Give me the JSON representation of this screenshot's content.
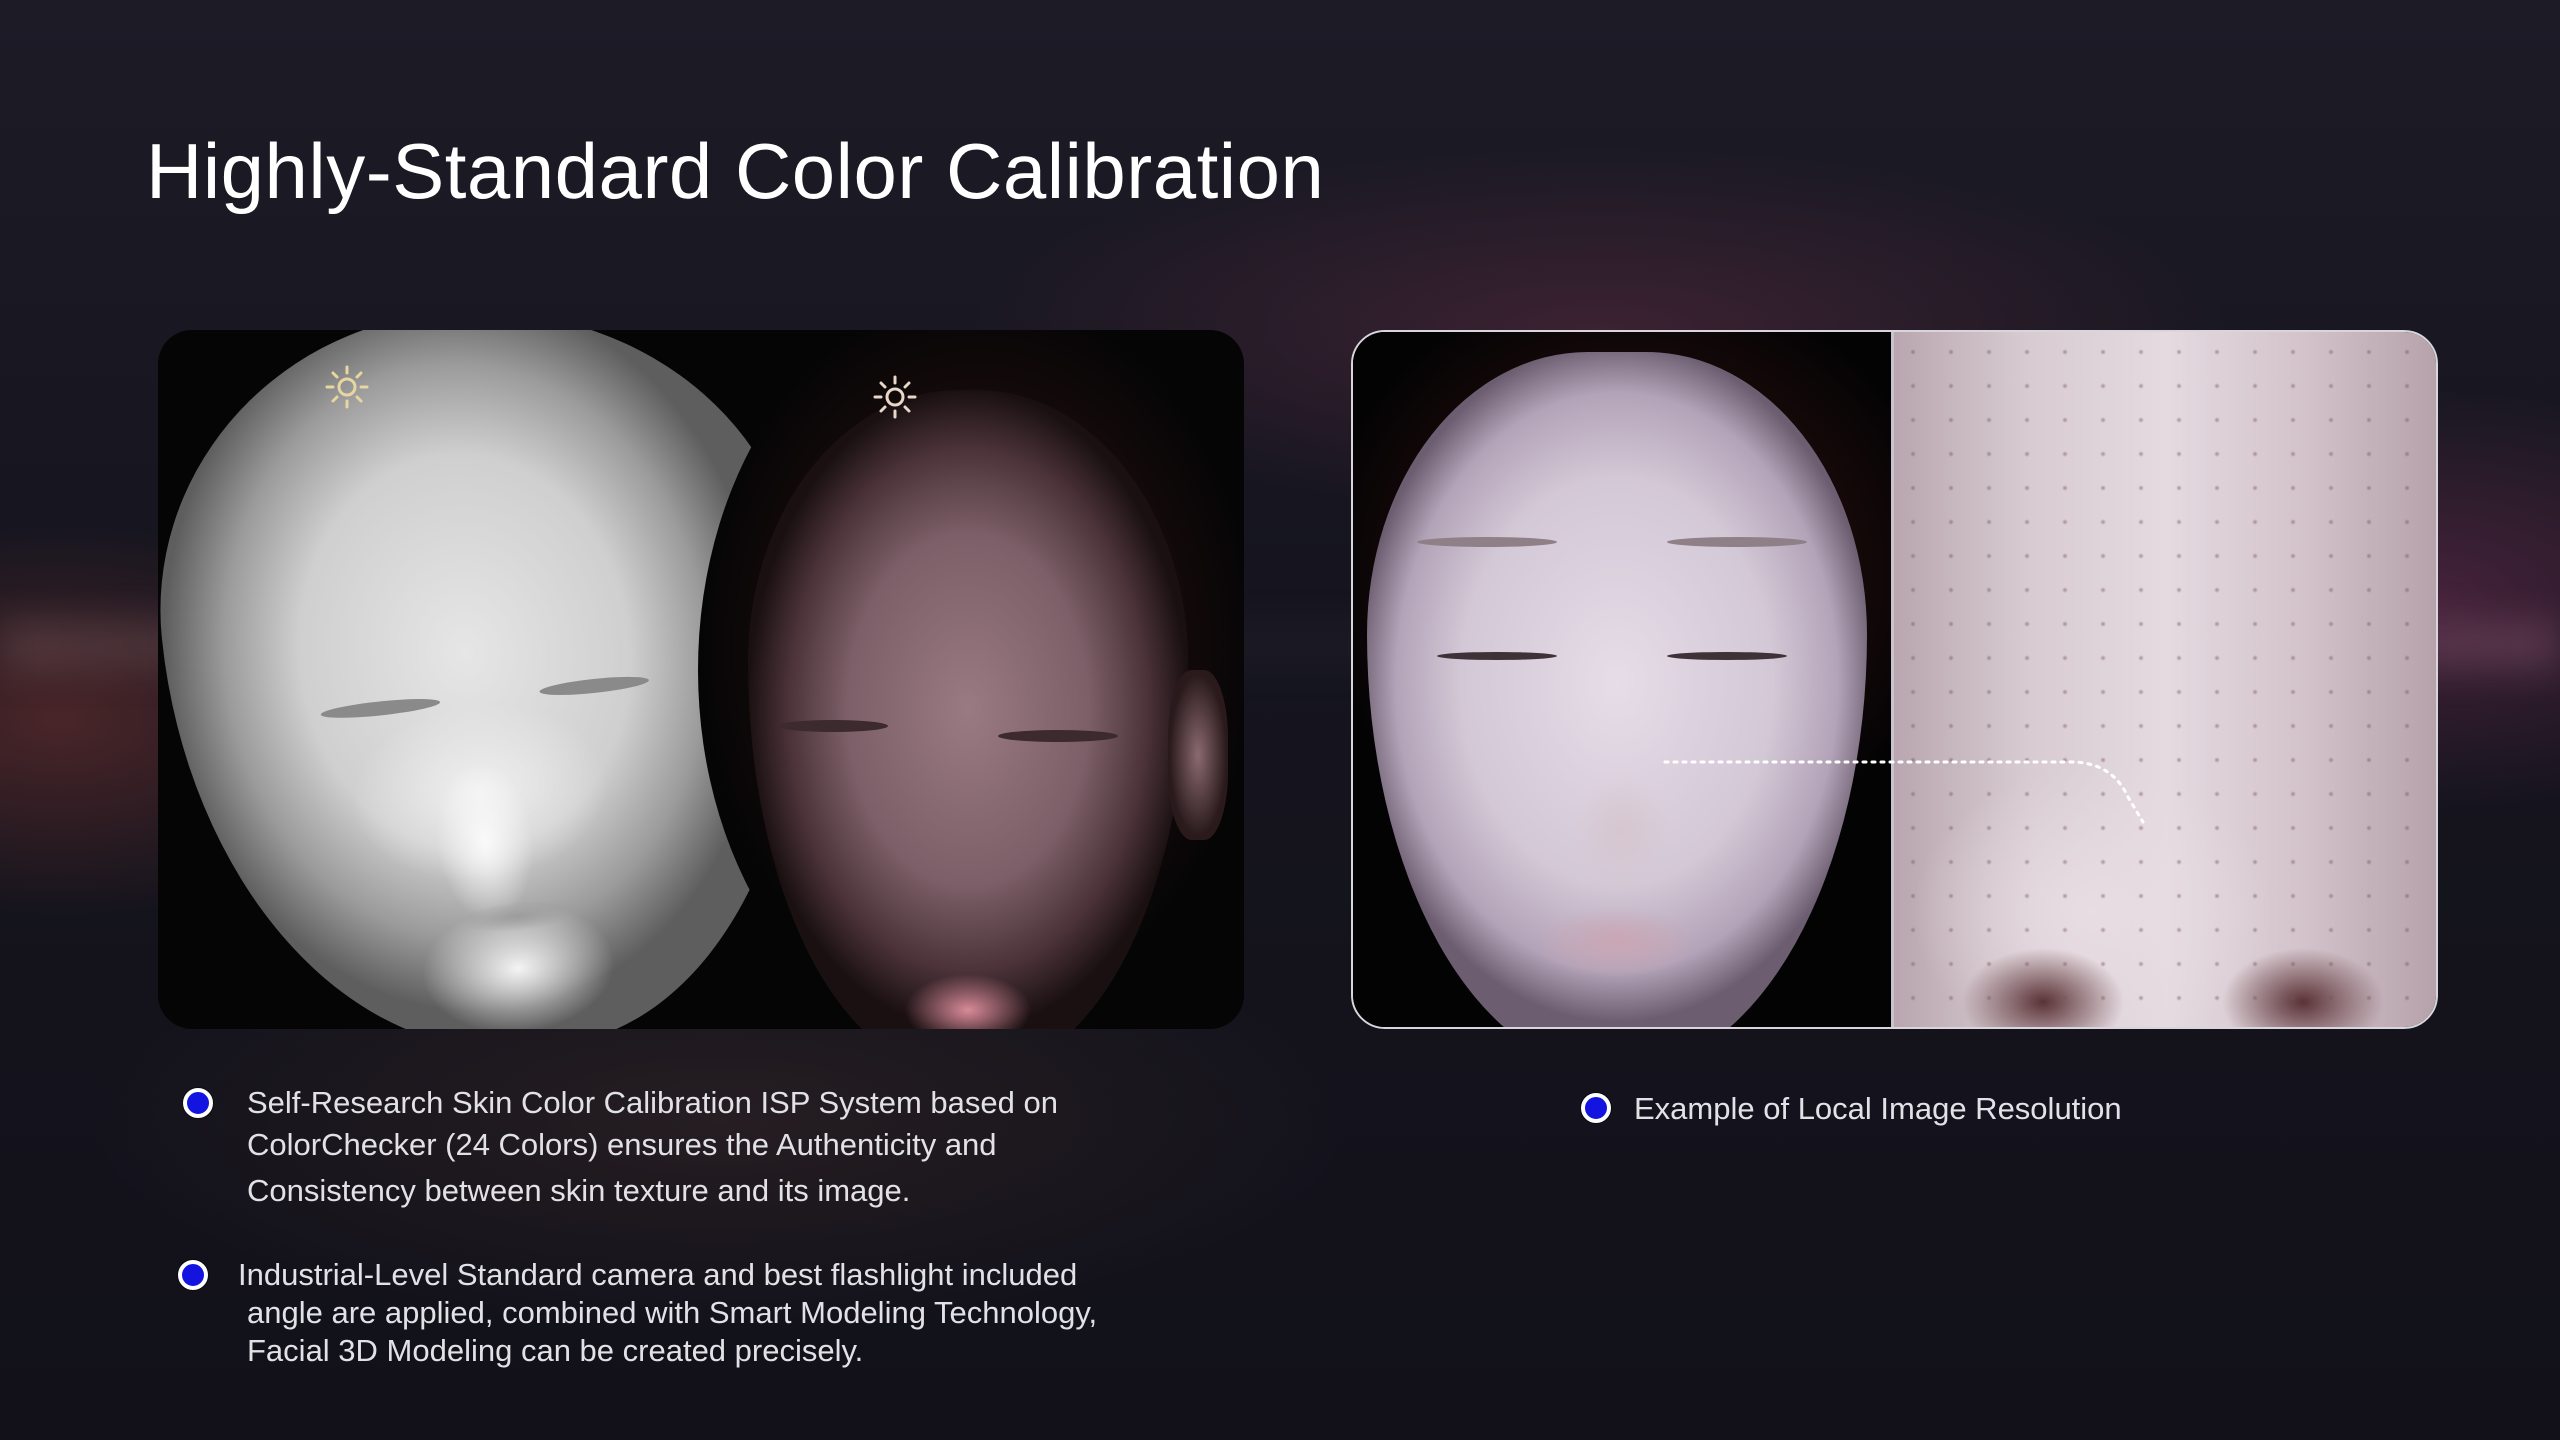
{
  "title": "Highly-Standard Color Calibration",
  "colors": {
    "background": "#16151f",
    "bullet": "#1414e0",
    "text": "#e2e1e6"
  },
  "left_panel": {
    "icons": [
      "sun-icon",
      "sun-icon"
    ]
  },
  "bullets_left": [
    {
      "lines": [
        "Self-Research Skin Color Calibration ISP System based on",
        "ColorChecker (24 Colors) ensures the Authenticity and",
        "Consistency between skin texture and its image."
      ]
    },
    {
      "lines": [
        "Industrial-Level Standard camera and best flashlight included",
        "angle are applied, combined with Smart Modeling Technology,",
        "Facial 3D Modeling can be created precisely."
      ]
    }
  ],
  "bullet_right": {
    "text": "Example of Local Image Resolution"
  }
}
